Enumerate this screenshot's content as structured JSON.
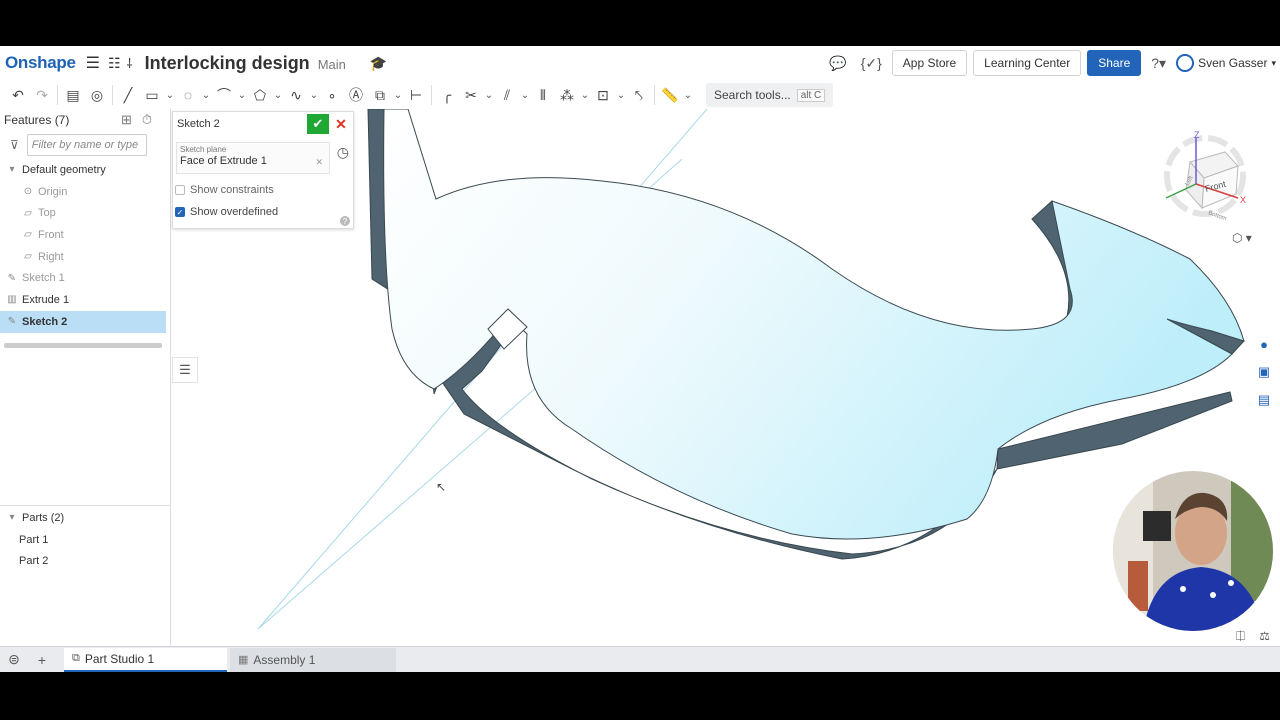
{
  "header": {
    "logo": "Onshape",
    "doc_title": "Interlocking design",
    "branch": "Main",
    "app_store": "App Store",
    "learning_center": "Learning Center",
    "share": "Share",
    "user_name": "Sven Gasser"
  },
  "toolbar": {
    "search_label": "Search tools...",
    "search_shortcut": "alt C"
  },
  "features": {
    "title": "Features (7)",
    "filter_placeholder": "Filter by name or type",
    "default_geometry": "Default geometry",
    "items": [
      {
        "label": "Origin"
      },
      {
        "label": "Top"
      },
      {
        "label": "Front"
      },
      {
        "label": "Right"
      },
      {
        "label": "Sketch 1"
      },
      {
        "label": "Extrude 1"
      },
      {
        "label": "Sketch 2"
      }
    ]
  },
  "parts": {
    "title": "Parts (2)",
    "items": [
      {
        "label": "Part 1"
      },
      {
        "label": "Part 2"
      }
    ]
  },
  "sketch_dialog": {
    "title": "Sketch 2",
    "plane_label": "Sketch plane",
    "plane_value": "Face of Extrude 1",
    "show_constraints": "Show constraints",
    "show_overdefined": "Show overdefined",
    "show_constraints_checked": false,
    "show_overdefined_checked": true
  },
  "viewcube": {
    "front": "Front",
    "left": "Left",
    "bottom": "Bottom",
    "z": "Z",
    "x": "X"
  },
  "tabs": [
    {
      "label": "Part Studio 1",
      "active": true
    },
    {
      "label": "Assembly 1",
      "active": false
    }
  ],
  "colors": {
    "brand": "#1e63b5",
    "accent": "#2164b9",
    "part_top": "#d8f3fb",
    "part_side": "#4f6470",
    "confirm": "#1fa834"
  }
}
